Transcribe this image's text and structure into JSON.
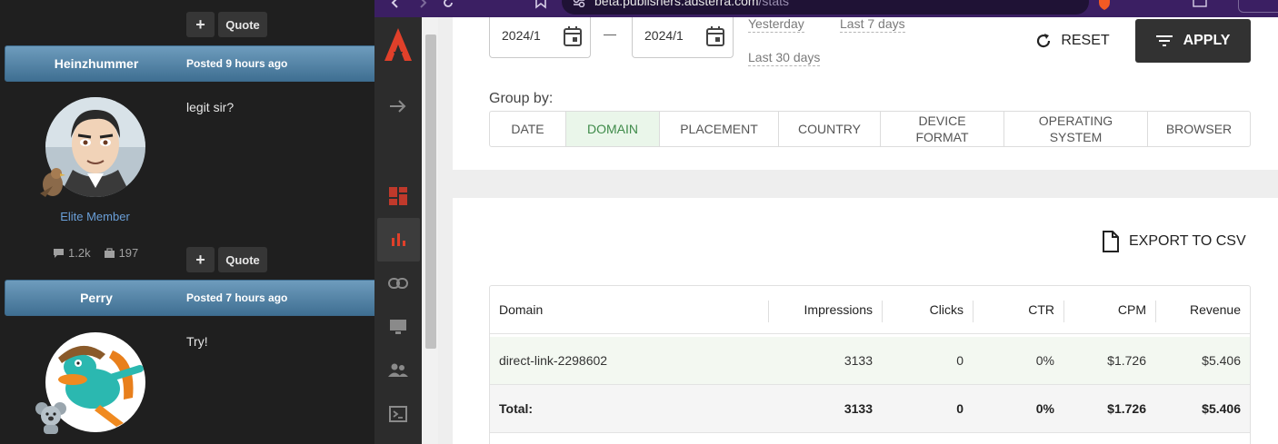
{
  "forum": {
    "plus_label": "+",
    "quote_label": "Quote",
    "posts": [
      {
        "author": "Heinzhummer",
        "posted": "Posted 9 hours ago",
        "text": "legit sir?",
        "rank": "Elite Member",
        "comments": "1.2k",
        "badges": "197"
      },
      {
        "author": "Perry",
        "posted": "Posted 7 hours ago",
        "text": "Try!"
      }
    ]
  },
  "browser": {
    "url_host": "beta.publishers.adsterra.com",
    "url_path": "/stats"
  },
  "filters": {
    "date_from": "2024/1",
    "date_to": "2024/1",
    "dash": "—",
    "presets": [
      "Yesterday",
      "Last 7 days",
      "Last 30 days"
    ],
    "reset_label": "RESET",
    "apply_label": "APPLY",
    "groupby_label": "Group by:",
    "groupby_tabs": [
      {
        "line1": "DATE",
        "line2": ""
      },
      {
        "line1": "DOMAIN",
        "line2": ""
      },
      {
        "line1": "PLACEMENT",
        "line2": ""
      },
      {
        "line1": "COUNTRY",
        "line2": ""
      },
      {
        "line1": "DEVICE",
        "line2": "FORMAT"
      },
      {
        "line1": "OPERATING",
        "line2": "SYSTEM"
      },
      {
        "line1": "BROWSER",
        "line2": ""
      }
    ],
    "active_tab": "DOMAIN"
  },
  "export_label": "EXPORT TO CSV",
  "table": {
    "columns": [
      "Domain",
      "Impressions",
      "Clicks",
      "CTR",
      "CPM",
      "Revenue"
    ],
    "rows": [
      [
        "direct-link-2298602",
        "3133",
        "0",
        "0%",
        "$1.726",
        "$5.406"
      ]
    ],
    "total": [
      "Total:",
      "3133",
      "0",
      "0%",
      "$1.726",
      "$5.406"
    ]
  },
  "colors": {
    "accent_red": "#e0402a",
    "active_green": "#3f8b4a",
    "post_header_blue": "#4f7fa3",
    "browser_purple": "#3b1f63"
  }
}
